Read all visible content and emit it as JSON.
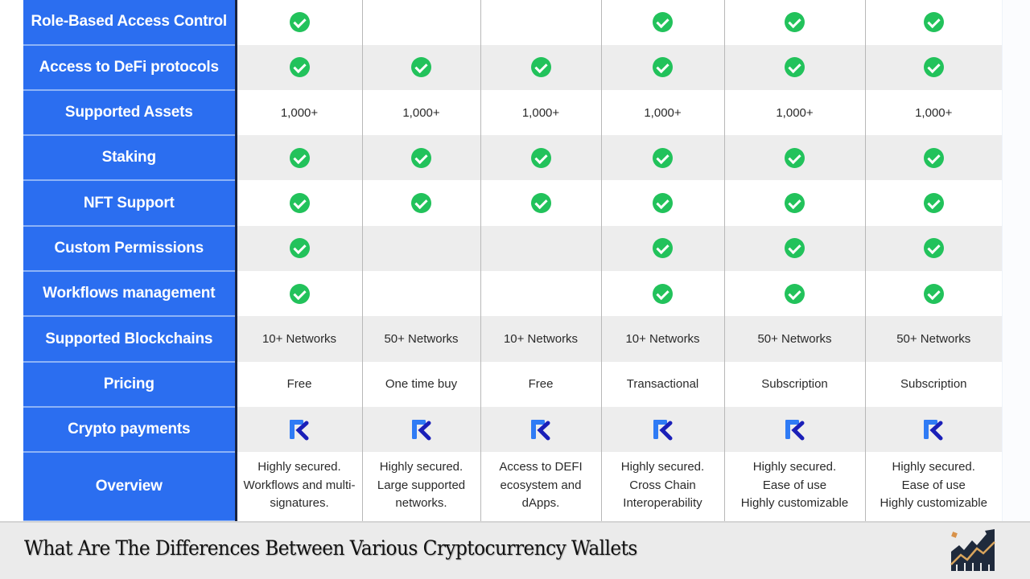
{
  "table": {
    "rows": [
      {
        "label": "",
        "cells": [
          "",
          "",
          "",
          "",
          "",
          ""
        ],
        "types": [
          "blank",
          "blank",
          "blank",
          "blank",
          "blank",
          "blank"
        ]
      },
      {
        "label": "Role-Based Access Control",
        "types": [
          "check",
          "blank",
          "blank",
          "check",
          "check",
          "check"
        ],
        "cells": [
          "",
          "",
          "",
          "",
          "",
          ""
        ]
      },
      {
        "label": "Access to DeFi protocols",
        "types": [
          "check",
          "check",
          "check",
          "check",
          "check",
          "check"
        ],
        "cells": [
          "",
          "",
          "",
          "",
          "",
          ""
        ]
      },
      {
        "label": "Supported Assets",
        "types": [
          "text",
          "text",
          "text",
          "text",
          "text",
          "text"
        ],
        "cells": [
          "1,000+",
          "1,000+",
          "1,000+",
          "1,000+",
          "1,000+",
          "1,000+"
        ]
      },
      {
        "label": "Staking",
        "types": [
          "check",
          "check",
          "check",
          "check",
          "check",
          "check"
        ],
        "cells": [
          "",
          "",
          "",
          "",
          "",
          ""
        ]
      },
      {
        "label": "NFT Support",
        "types": [
          "check",
          "check",
          "check",
          "check",
          "check",
          "check"
        ],
        "cells": [
          "",
          "",
          "",
          "",
          "",
          ""
        ]
      },
      {
        "label": "Custom Permissions",
        "types": [
          "check",
          "blank",
          "blank",
          "check",
          "check",
          "check"
        ],
        "cells": [
          "",
          "",
          "",
          "",
          "",
          ""
        ]
      },
      {
        "label": "Workflows management",
        "types": [
          "check",
          "blank",
          "blank",
          "check",
          "check",
          "check"
        ],
        "cells": [
          "",
          "",
          "",
          "",
          "",
          ""
        ]
      },
      {
        "label": "Supported Blockchains",
        "types": [
          "text",
          "text",
          "text",
          "text",
          "text",
          "text"
        ],
        "cells": [
          "10+ Networks",
          "50+ Networks",
          "10+ Networks",
          "10+ Networks",
          "50+ Networks",
          "50+ Networks"
        ]
      },
      {
        "label": "Pricing",
        "types": [
          "text",
          "text",
          "text",
          "text",
          "text",
          "text"
        ],
        "cells": [
          "Free",
          "One time buy",
          "Free",
          "Transactional",
          "Subscription",
          "Subscription"
        ]
      },
      {
        "label": "Crypto payments",
        "types": [
          "logo",
          "logo",
          "logo",
          "logo",
          "logo",
          "logo"
        ],
        "cells": [
          "",
          "",
          "",
          "",
          "",
          ""
        ]
      },
      {
        "label": "Overview",
        "types": [
          "text",
          "text",
          "text",
          "text",
          "text",
          "text"
        ],
        "cells": [
          "Highly secured.\nWorkflows and multi-\nsignatures.",
          "Highly secured.\nLarge supported\nnetworks.",
          "Access to DEFI\necosystem and\ndApps.",
          "Highly secured.\nCross Chain\nInteroperability",
          "Highly secured.\nEase of use\nHighly customizable",
          "Highly secured.\nEase of use\nHighly customizable"
        ]
      }
    ]
  },
  "icons": {
    "check": "check-circle-icon",
    "logo": "request-r-logo-icon"
  },
  "colors": {
    "label_bg": "#2b6ef0",
    "check": "#22c25b",
    "alt_row": "#ededed",
    "logo_light": "#2f7bf5",
    "logo_dark": "#1a1fb8"
  },
  "footer": {
    "title": "What Are The Differences Between Various Cryptocurrency Wallets",
    "logo": "growth-chart-logo-icon"
  }
}
